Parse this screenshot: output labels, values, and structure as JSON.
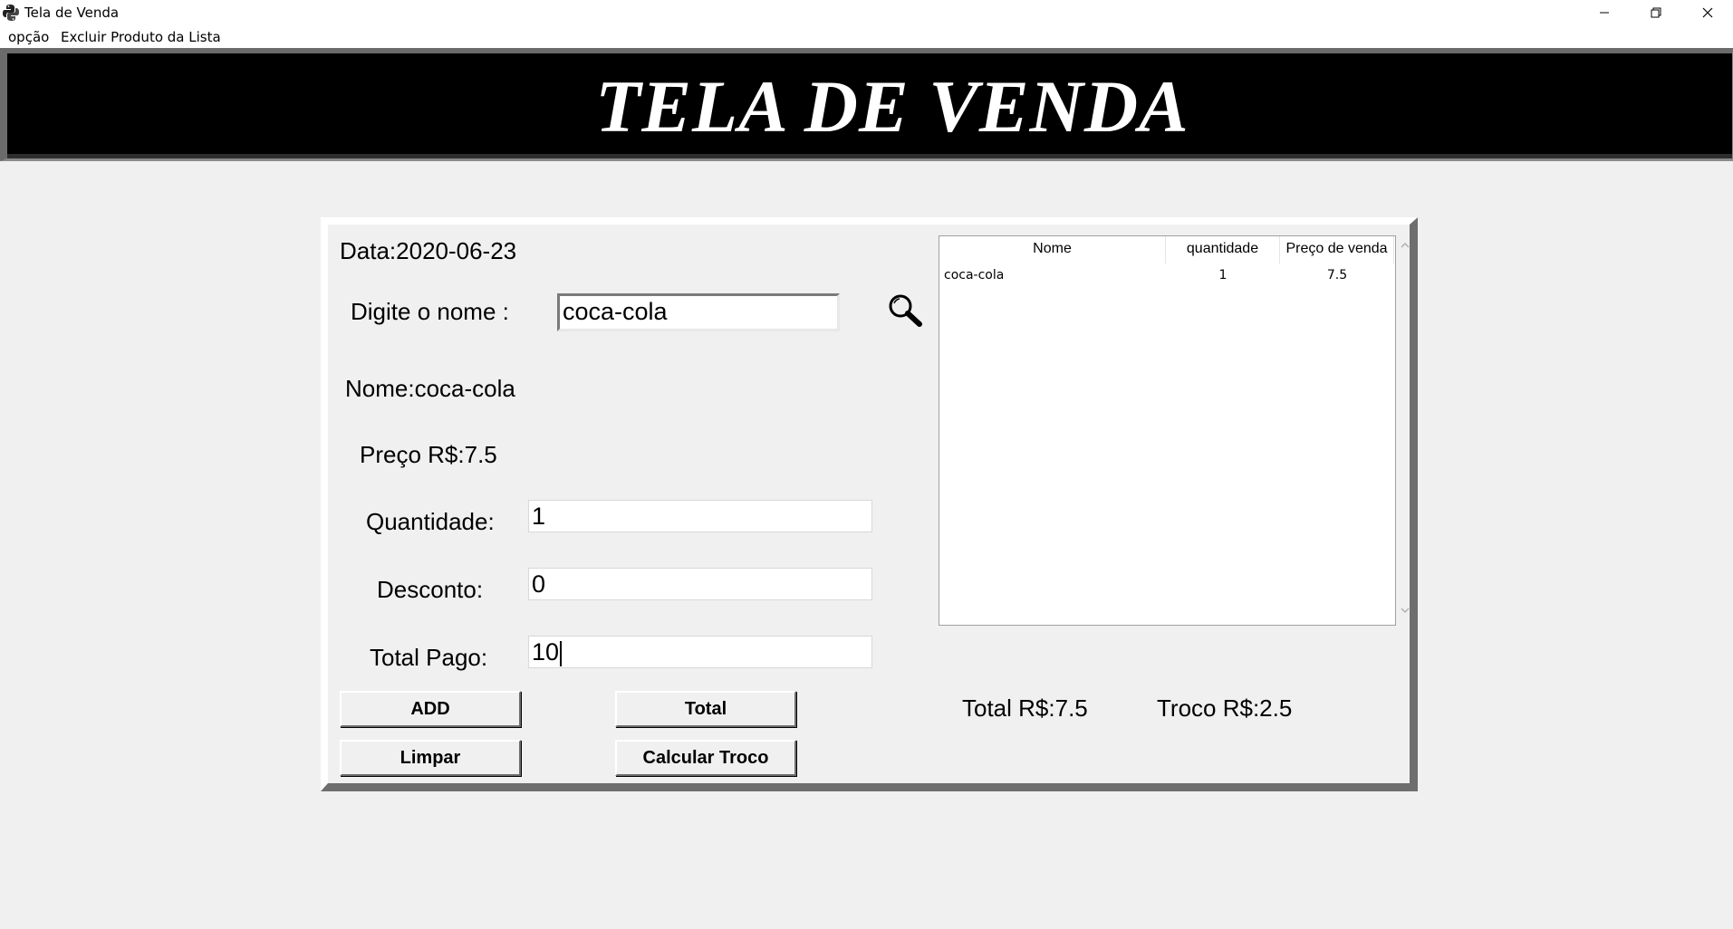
{
  "window": {
    "title": "Tela de Venda",
    "minimize_label": "—",
    "close_label": "✕"
  },
  "menu": {
    "items": [
      "opção",
      "Excluir Produto da Lista"
    ]
  },
  "banner": {
    "title": "TELA DE VENDA"
  },
  "form": {
    "date_label": "Data:2020-06-23",
    "search_label": "Digite o nome :",
    "search_value": "coca-cola",
    "name_label": "Nome:coca-cola",
    "price_label": "Preço R$:7.5",
    "quantity_label": "Quantidade:",
    "quantity_value": "1",
    "discount_label": "Desconto:",
    "discount_value": "0",
    "paid_label": "Total Pago:",
    "paid_value": "10"
  },
  "buttons": {
    "add": "ADD",
    "total": "Total",
    "clear": "Limpar",
    "change": "Calcular Troco"
  },
  "summary": {
    "total": "Total R$:7.5",
    "change": "Troco R$:2.5"
  },
  "table": {
    "columns": [
      "Nome",
      "quantidade",
      "Preço de venda"
    ],
    "rows": [
      [
        "coca-cola",
        "1",
        "7.5"
      ]
    ]
  }
}
